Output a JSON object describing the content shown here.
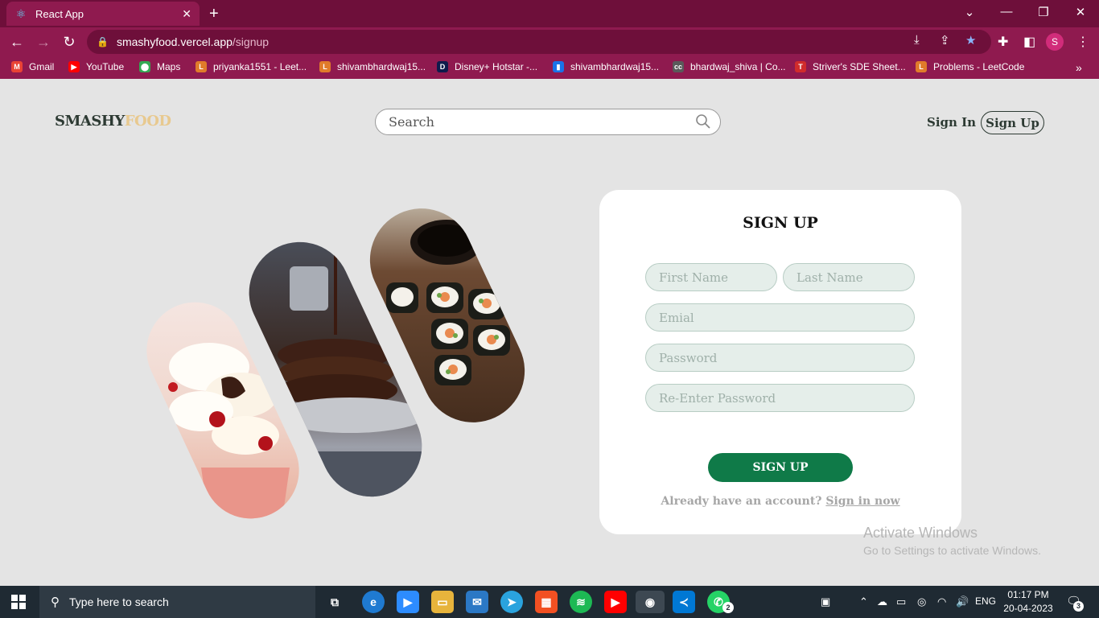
{
  "browser": {
    "tab_title": "React App",
    "url_host": "smashyfood.vercel.app",
    "url_path": "/signup",
    "profile_initial": "S",
    "bookmarks": [
      {
        "label": "Gmail",
        "color": "#ea4335",
        "icon": "gmail-icon"
      },
      {
        "label": "YouTube",
        "color": "#ff0000",
        "icon": "youtube-icon"
      },
      {
        "label": "Maps",
        "color": "#34a853",
        "icon": "maps-icon"
      },
      {
        "label": "priyanka1551 - Leet...",
        "color": "#e07b2a",
        "icon": "leetcode-icon"
      },
      {
        "label": "shivambhardwaj15...",
        "color": "#e07b2a",
        "icon": "leetcode-icon"
      },
      {
        "label": "Disney+ Hotstar -...",
        "color": "#0f1b4c",
        "icon": "hotstar-icon"
      },
      {
        "label": "shivambhardwaj15...",
        "color": "#1a73e8",
        "icon": "chart-icon"
      },
      {
        "label": "bhardwaj_shiva | Co...",
        "color": "#5a5a5a",
        "icon": "codechef-icon"
      },
      {
        "label": "Striver's SDE Sheet...",
        "color": "#d12c2c",
        "icon": "tuf-icon"
      },
      {
        "label": "Problems - LeetCode",
        "color": "#e07b2a",
        "icon": "leetcode-icon"
      }
    ]
  },
  "header": {
    "brand_part1": "SMASHY",
    "brand_part2": "FOOD",
    "search_placeholder": "Search",
    "signin_label": "Sign In",
    "signup_label": "Sign Up"
  },
  "form": {
    "title": "SIGN UP",
    "first_name_placeholder": "First Name",
    "last_name_placeholder": "Last Name",
    "email_placeholder": "Emial",
    "password_placeholder": "Password",
    "reenter_placeholder": "Re-Enter Password",
    "submit_label": "SIGN UP",
    "already_text": "Already have an account?",
    "signin_link": "Sign in now"
  },
  "watermark": {
    "line1": "Activate Windows",
    "line2": "Go to Settings to activate Windows."
  },
  "taskbar": {
    "search_placeholder": "Type here to search",
    "lang": "ENG",
    "time": "01:17 PM",
    "date": "20-04-2023",
    "whatsapp_badge": "2",
    "notif_count": "3"
  },
  "colors": {
    "chrome_dark": "#6e0f3a",
    "chrome": "#8f1a4f",
    "accent_green": "#0f7a48",
    "brand_gold": "#e8c98f"
  }
}
